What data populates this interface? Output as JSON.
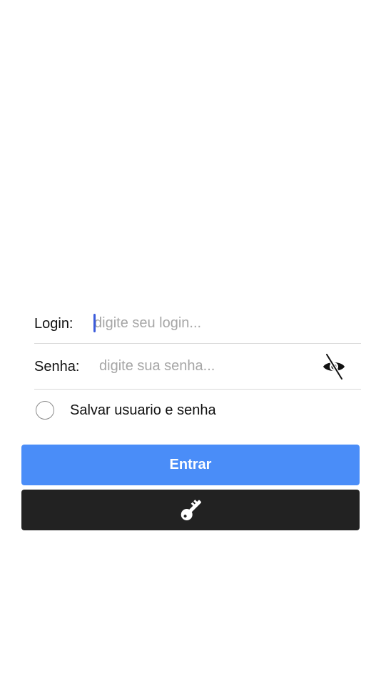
{
  "form": {
    "login": {
      "label": "Login:",
      "value": "",
      "placeholder": "digite seu login..."
    },
    "password": {
      "label": "Senha:",
      "value": "",
      "placeholder": "digite sua senha...",
      "toggle_icon": "eye-slash-icon"
    },
    "remember": {
      "label": "Salvar usuario e senha",
      "checked": false
    }
  },
  "buttons": {
    "enter_label": "Entrar",
    "key_icon": "key-icon"
  },
  "colors": {
    "primary": "#4a8df8",
    "dark": "#222222",
    "caret": "#3b5bdb",
    "placeholder": "#a6a6a6",
    "divider": "#d9d9d9"
  }
}
